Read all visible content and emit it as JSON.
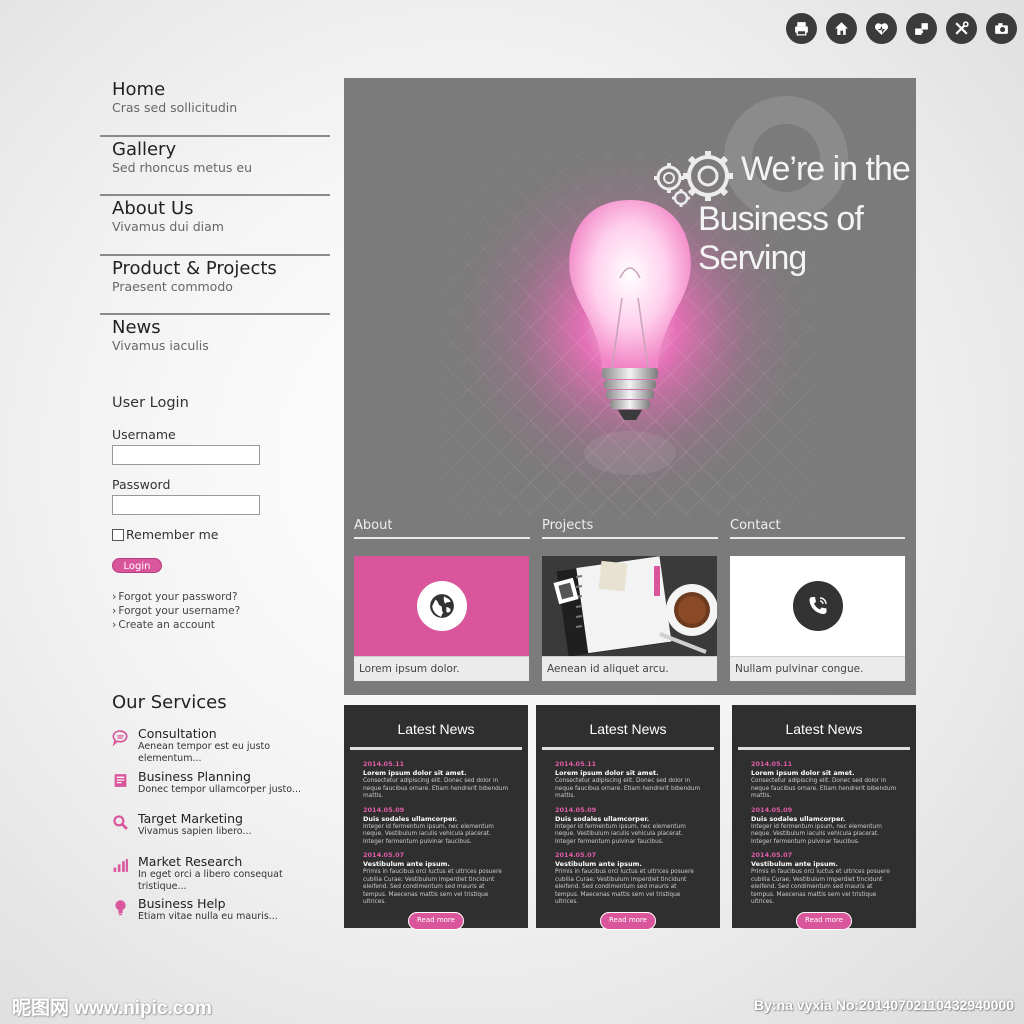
{
  "topbar": {
    "icons": [
      "printer-icon",
      "home-icon",
      "heart-icon",
      "puzzle-icon",
      "tools-icon",
      "camera-icon"
    ]
  },
  "nav": {
    "items": [
      {
        "title": "Home",
        "sub": "Cras sed sollicitudin"
      },
      {
        "title": "Gallery",
        "sub": "Sed rhoncus metus eu"
      },
      {
        "title": "About Us",
        "sub": "Vivamus dui diam"
      },
      {
        "title": "Product & Projects",
        "sub": "Praesent commodo"
      },
      {
        "title": "News",
        "sub": "Vivamus iaculis"
      }
    ]
  },
  "login": {
    "heading": "User Login",
    "username_label": "Username",
    "username_value": "",
    "password_label": "Password",
    "password_value": "",
    "remember": "Remember me",
    "button": "Login",
    "links": [
      "Forgot your password?",
      "Forgot your username?",
      "Create an account"
    ]
  },
  "services": {
    "heading": "Our Services",
    "items": [
      {
        "title": "Consultation",
        "desc": "Aenean tempor est eu justo elementum...",
        "icon": "chat-bubble-icon"
      },
      {
        "title": "Business Planning",
        "desc": "Donec tempor ullamcorper justo...",
        "icon": "document-icon"
      },
      {
        "title": "Target Marketing",
        "desc": "Vivamus sapien libero...",
        "icon": "magnifier-icon"
      },
      {
        "title": "Market Research",
        "desc": "In eget orci a libero consequat tristique...",
        "icon": "bar-chart-icon"
      },
      {
        "title": "Business Help",
        "desc": "Etiam vitae nulla eu mauris...",
        "icon": "lightbulb-icon"
      }
    ]
  },
  "hero": {
    "line1": "We’re in the",
    "line2": "Business of Serving",
    "accent": "#e05ca8",
    "tabs": [
      "About",
      "Projects",
      "Contact"
    ],
    "cards": [
      {
        "caption": "Lorem ipsum dolor.",
        "icon": "globe-icon",
        "color": "#d9559c"
      },
      {
        "caption": "Aenean id aliquet arcu.",
        "icon": "notebook-coffee-image",
        "color": "#444444"
      },
      {
        "caption": "Nullam pulvinar congue.",
        "icon": "phone-icon",
        "color": "#ffffff"
      }
    ]
  },
  "news": {
    "heading": "Latest News",
    "read_more": "Read more",
    "items": [
      {
        "date": "2014.05.11",
        "title": "Lorem ipsum dolor sit amet.",
        "body": "Consectetur adipiscing elit. Donec sed dolor in neque faucibus ornare. Etiam hendrerit bibendum mattis."
      },
      {
        "date": "2014.05.09",
        "title": "Duis sodales ullamcorper.",
        "body": "Integer id fermentum ipsum, nec elementum neque. Vestibulum iaculis vehicula placerat. Integer fermentum pulvinar faucibus."
      },
      {
        "date": "2014.05.07",
        "title": "Vestibulum ante ipsum.",
        "body": "Primis in faucibus orci luctus et ultrices posuere cubilia Curae; Vestibulum imperdiet tincidunt eleifend. Sed condimentum sed mauris at tempus. Maecenas mattis sem vel tristique ultrices."
      }
    ]
  },
  "watermark": {
    "left": "昵图网 www.nipic.com",
    "right": "By:na vyxia No:20140702110432940000"
  }
}
